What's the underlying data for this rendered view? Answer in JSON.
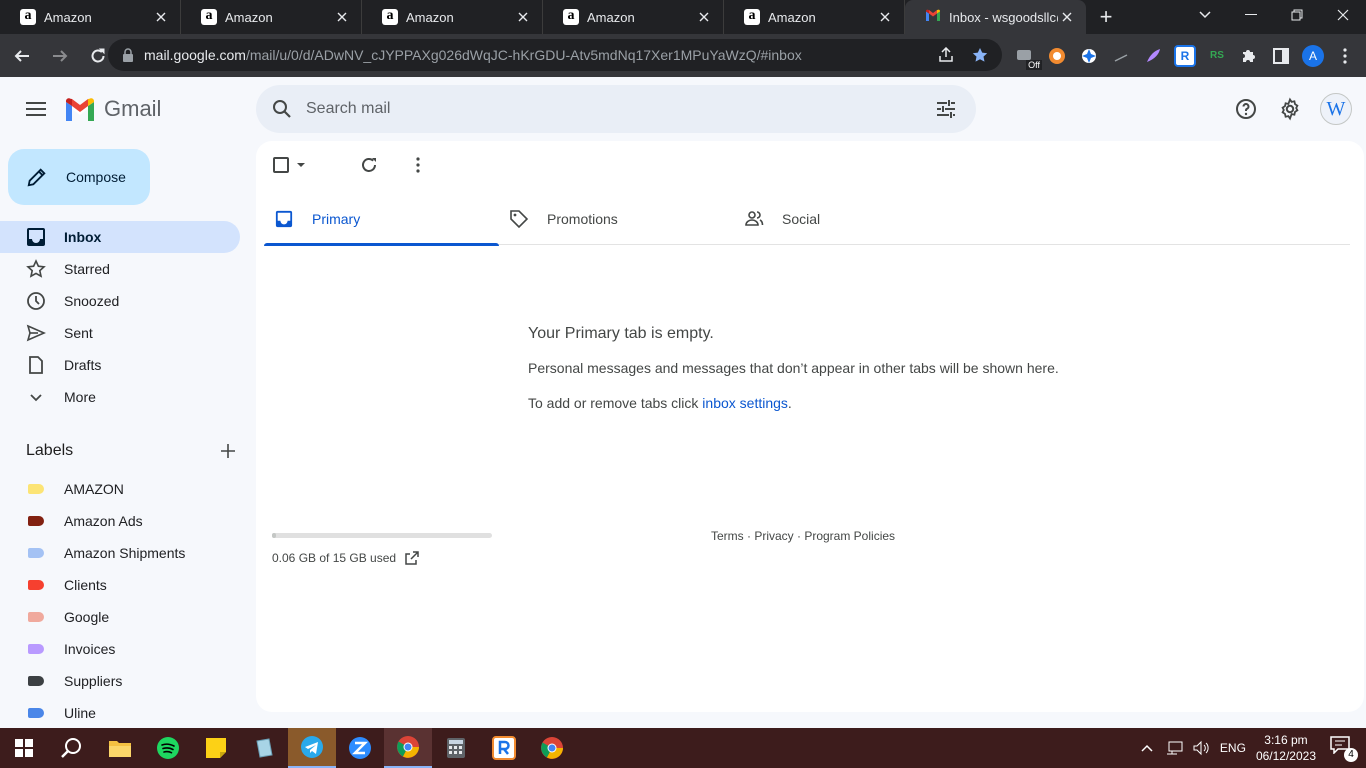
{
  "browser": {
    "tabs": [
      {
        "title": "Amazon",
        "favicon": "a"
      },
      {
        "title": "Amazon",
        "favicon": "a"
      },
      {
        "title": "Amazon",
        "favicon": "a"
      },
      {
        "title": "Amazon",
        "favicon": "a"
      },
      {
        "title": "Amazon",
        "favicon": "a"
      },
      {
        "title": "Inbox - wsgoodsllc@",
        "favicon": "gmail"
      }
    ],
    "url_host": "mail.google.com",
    "url_path": "/mail/u/0/d/ADwNV_cJYPPAXg026dWqJC-hKrGDU-Atv5mdNq17Xer1MPuYaWzQ/#inbox",
    "ext_off_badge": "Off",
    "profile_initial": "A"
  },
  "gmail": {
    "logo_text": "Gmail",
    "search_placeholder": "Search mail",
    "account_initial": "W",
    "compose_label": "Compose",
    "nav": [
      {
        "label": "Inbox",
        "icon": "inbox-icon",
        "active": true
      },
      {
        "label": "Starred",
        "icon": "star-icon"
      },
      {
        "label": "Snoozed",
        "icon": "clock-icon"
      },
      {
        "label": "Sent",
        "icon": "send-icon"
      },
      {
        "label": "Drafts",
        "icon": "draft-icon"
      },
      {
        "label": "More",
        "icon": "chevron-down-icon"
      }
    ],
    "labels_title": "Labels",
    "labels": [
      {
        "name": "AMAZON",
        "color": "#fce475"
      },
      {
        "name": "Amazon Ads",
        "color": "#822111"
      },
      {
        "name": "Amazon Shipments",
        "color": "#a4c2f4"
      },
      {
        "name": "Clients",
        "color": "#f6402f"
      },
      {
        "name": "Google",
        "color": "#f0a99d"
      },
      {
        "name": "Invoices",
        "color": "#b99aff"
      },
      {
        "name": "Suppliers",
        "color": "#3c4043"
      },
      {
        "name": "Uline",
        "color": "#4a86e8"
      }
    ],
    "tabs": [
      {
        "label": "Primary",
        "icon": "inbox-tab-icon",
        "active": true
      },
      {
        "label": "Promotions",
        "icon": "tag-icon"
      },
      {
        "label": "Social",
        "icon": "people-icon"
      }
    ],
    "empty_title": "Your Primary tab is empty.",
    "empty_body": "Personal messages and messages that don’t appear in other tabs will be shown here.",
    "empty_settings_prefix": "To add or remove tabs click ",
    "empty_settings_link": "inbox settings",
    "empty_settings_suffix": ".",
    "storage_text": "0.06 GB of 15 GB used",
    "storage_fraction": 0.004,
    "footer_links": "Terms · Privacy · Program Policies"
  },
  "taskbar": {
    "time": "3:16 pm",
    "date": "06/12/2023",
    "lang": "ENG",
    "notification_count": "4"
  }
}
